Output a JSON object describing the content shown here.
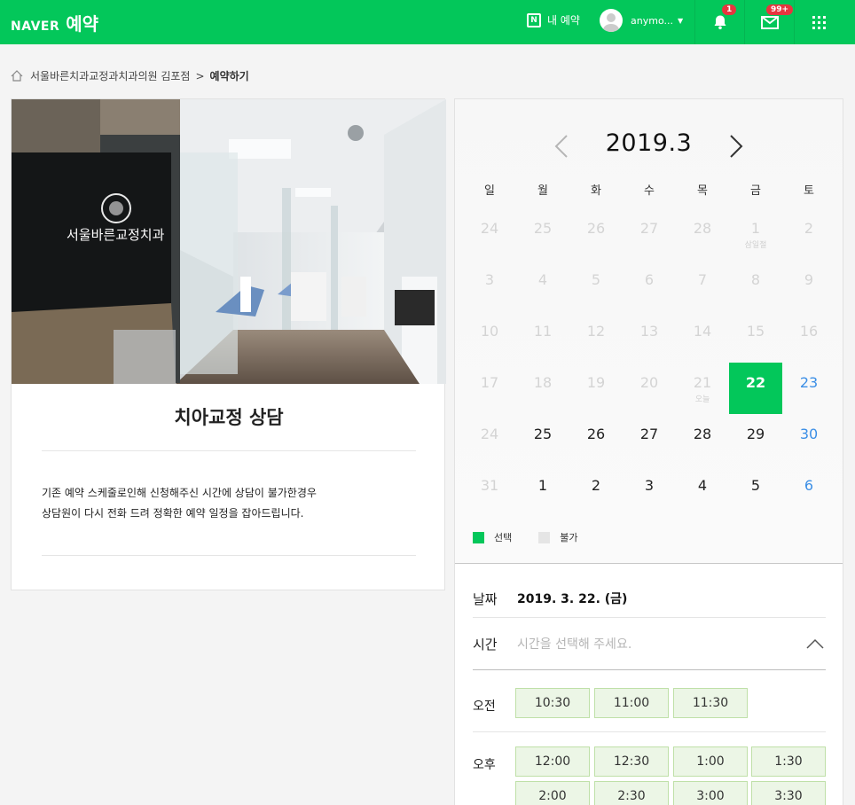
{
  "header": {
    "brand": "NAVER",
    "service": "예약",
    "my_reservation": "내 예약",
    "user_name": "anymo...",
    "notifications_count": "1",
    "mail_count": "99+",
    "accent_color": "#03c75a"
  },
  "breadcrumb": {
    "clinic": "서울바른치과교정과치과의원 김포점",
    "separator": ">",
    "current": "예약하기"
  },
  "service": {
    "title": "치아교정 상담",
    "description_line1": "기존 예약 스케줄로인해 신청해주신 시간에 상담이 불가한경우",
    "description_line2": "상담원이 다시 전화 드려 정확한 예약 일정을 잡아드립니다.",
    "photo_sign": "서울바른교정치과"
  },
  "calendar": {
    "month_label": "2019.3",
    "weekdays": [
      "일",
      "월",
      "화",
      "수",
      "목",
      "금",
      "토"
    ],
    "days": [
      {
        "d": "24",
        "s": "off"
      },
      {
        "d": "25",
        "s": "off"
      },
      {
        "d": "26",
        "s": "off"
      },
      {
        "d": "27",
        "s": "off"
      },
      {
        "d": "28",
        "s": "off"
      },
      {
        "d": "1",
        "s": "off",
        "sub": "삼일절"
      },
      {
        "d": "2",
        "s": "off"
      },
      {
        "d": "3",
        "s": "off"
      },
      {
        "d": "4",
        "s": "off"
      },
      {
        "d": "5",
        "s": "off"
      },
      {
        "d": "6",
        "s": "off"
      },
      {
        "d": "7",
        "s": "off"
      },
      {
        "d": "8",
        "s": "off"
      },
      {
        "d": "9",
        "s": "off"
      },
      {
        "d": "10",
        "s": "off"
      },
      {
        "d": "11",
        "s": "off"
      },
      {
        "d": "12",
        "s": "off"
      },
      {
        "d": "13",
        "s": "off"
      },
      {
        "d": "14",
        "s": "off"
      },
      {
        "d": "15",
        "s": "off"
      },
      {
        "d": "16",
        "s": "off"
      },
      {
        "d": "17",
        "s": "off"
      },
      {
        "d": "18",
        "s": "off"
      },
      {
        "d": "19",
        "s": "off"
      },
      {
        "d": "20",
        "s": "off"
      },
      {
        "d": "21",
        "s": "off",
        "sub": "오늘"
      },
      {
        "d": "22",
        "s": "sel"
      },
      {
        "d": "23",
        "s": "sat"
      },
      {
        "d": "24",
        "s": "off"
      },
      {
        "d": "25",
        "s": "avail"
      },
      {
        "d": "26",
        "s": "avail"
      },
      {
        "d": "27",
        "s": "avail"
      },
      {
        "d": "28",
        "s": "avail"
      },
      {
        "d": "29",
        "s": "avail"
      },
      {
        "d": "30",
        "s": "sat"
      },
      {
        "d": "31",
        "s": "off"
      },
      {
        "d": "1",
        "s": "avail"
      },
      {
        "d": "2",
        "s": "avail"
      },
      {
        "d": "3",
        "s": "avail"
      },
      {
        "d": "4",
        "s": "avail"
      },
      {
        "d": "5",
        "s": "avail"
      },
      {
        "d": "6",
        "s": "sat"
      }
    ],
    "legend_selected": "선택",
    "legend_unavailable": "불가"
  },
  "booking": {
    "date_label": "날짜",
    "date_value": "2019. 3. 22. (금)",
    "time_label": "시간",
    "time_placeholder": "시간을 선택해 주세요.",
    "am_label": "오전",
    "am_slots": [
      "10:30",
      "11:00",
      "11:30"
    ],
    "pm_label": "오후",
    "pm_slots": [
      "12:00",
      "12:30",
      "1:00",
      "1:30",
      "2:00",
      "2:30",
      "3:00",
      "3:30"
    ]
  }
}
